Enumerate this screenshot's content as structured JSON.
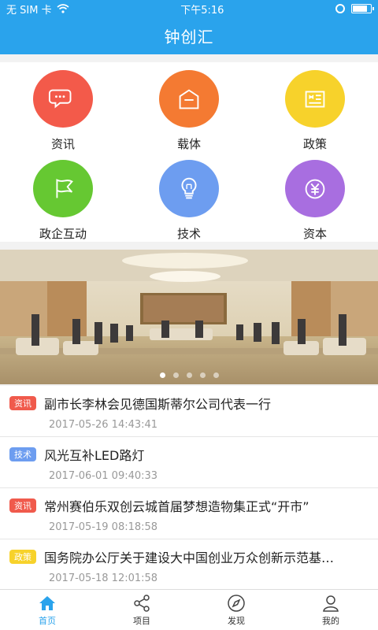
{
  "status_bar": {
    "carrier": "无 SIM 卡",
    "time": "下午5:16"
  },
  "app": {
    "title": "钟创汇"
  },
  "grid": [
    {
      "label": "资讯",
      "icon": "chat-bubbles-icon",
      "color": "#f35a4a"
    },
    {
      "label": "载体",
      "icon": "house-icon",
      "color": "#f47a32"
    },
    {
      "label": "政策",
      "icon": "flag-document-icon",
      "color": "#f7d22b"
    },
    {
      "label": "政企互动",
      "icon": "flag-icon",
      "color": "#66c832"
    },
    {
      "label": "技术",
      "icon": "lightbulb-icon",
      "color": "#6d9df0"
    },
    {
      "label": "资本",
      "icon": "yen-icon",
      "color": "#a86ee0"
    }
  ],
  "banner": {
    "pages": 5,
    "active_page": 1
  },
  "news": [
    {
      "tag": "资讯",
      "tag_color": "#f05a4c",
      "title": "副市长李林会见德国斯蒂尔公司代表一行",
      "date": "2017-05-26 14:43:41"
    },
    {
      "tag": "技术",
      "tag_color": "#6d9df0",
      "title": "风光互补LED路灯",
      "date": "2017-06-01 09:40:33"
    },
    {
      "tag": "资讯",
      "tag_color": "#f05a4c",
      "title": "常州赛伯乐双创云城首届梦想造物集正式“开市”",
      "date": "2017-05-19 08:18:58"
    },
    {
      "tag": "政策",
      "tag_color": "#f7d22b",
      "title": "国务院办公厅关于建设大中国创业万众创新示范基…",
      "date": "2017-05-18 12:01:58"
    }
  ],
  "tabs": [
    {
      "label": "首页",
      "icon": "home-icon",
      "active": true
    },
    {
      "label": "项目",
      "icon": "share-nodes-icon",
      "active": false
    },
    {
      "label": "发现",
      "icon": "compass-icon",
      "active": false
    },
    {
      "label": "我的",
      "icon": "person-icon",
      "active": false
    }
  ],
  "colors": {
    "accent": "#2aa3ec"
  }
}
